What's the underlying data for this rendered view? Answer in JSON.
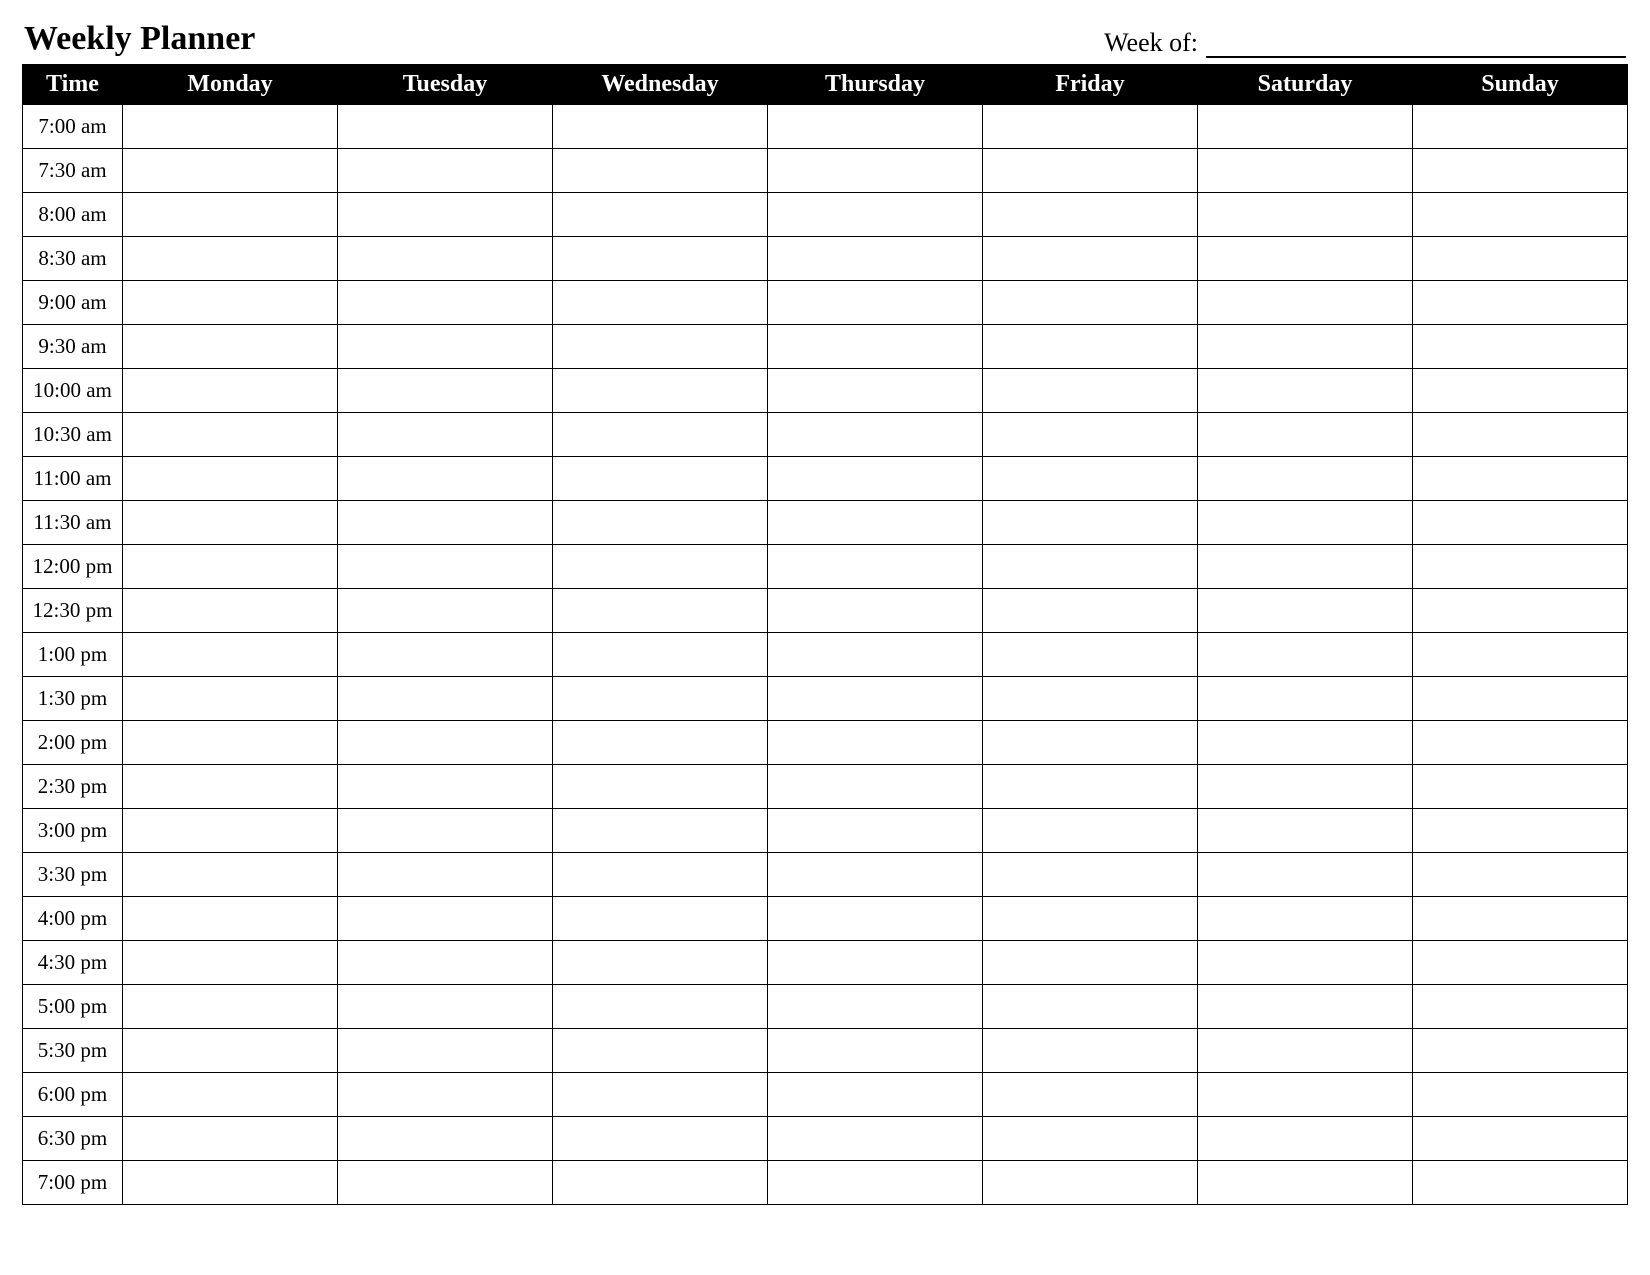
{
  "title": "Weekly Planner",
  "week_of_label": "Week of:",
  "week_of_value": "",
  "columns": [
    "Time",
    "Monday",
    "Tuesday",
    "Wednesday",
    "Thursday",
    "Friday",
    "Saturday",
    "Sunday"
  ],
  "times": [
    "7:00 am",
    "7:30 am",
    "8:00 am",
    "8:30 am",
    "9:00 am",
    "9:30 am",
    "10:00 am",
    "10:30 am",
    "11:00 am",
    "11:30 am",
    "12:00 pm",
    "12:30 pm",
    "1:00 pm",
    "1:30 pm",
    "2:00 pm",
    "2:30 pm",
    "3:00 pm",
    "3:30 pm",
    "4:00 pm",
    "4:30 pm",
    "5:00 pm",
    "5:30 pm",
    "6:00 pm",
    "6:30 pm",
    "7:00 pm"
  ],
  "cells": {}
}
